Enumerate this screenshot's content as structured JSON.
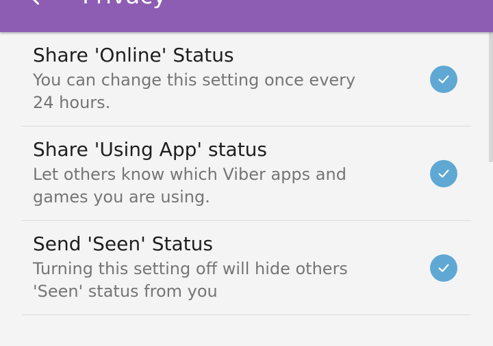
{
  "header": {
    "title": "Privacy",
    "back_icon": "arrow-back-icon",
    "bar_color": "#8d5db4"
  },
  "settings": {
    "items": [
      {
        "title": "Share 'Online' Status",
        "summary": "You can change this setting once every 24 hours.",
        "checked": true
      },
      {
        "title": "Share 'Using App' status",
        "summary": "Let others know which Viber apps and games you are using.",
        "checked": true
      },
      {
        "title": "Send 'Seen' Status",
        "summary": "Turning this setting off will hide others 'Seen' status from you",
        "checked": true
      }
    ],
    "check_color": "#5fa8d4"
  }
}
